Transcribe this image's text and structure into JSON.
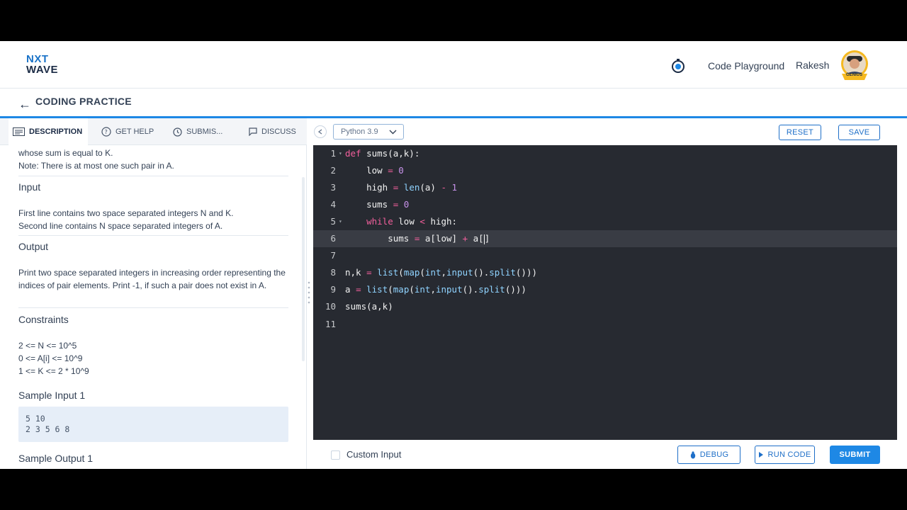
{
  "header": {
    "logo_line1": "NXT",
    "logo_line2": "WAVE",
    "nav_link": "Code Playground",
    "user_name": "Rakesh",
    "avatar_badge": "GENIUS"
  },
  "subheader": {
    "title": "CODING PRACTICE"
  },
  "tabs": [
    {
      "label": "DESCRIPTION",
      "icon": "description-icon",
      "active": true
    },
    {
      "label": "GET HELP",
      "icon": "help-icon",
      "active": false
    },
    {
      "label": "SUBMIS...",
      "icon": "clock-icon",
      "active": false
    },
    {
      "label": "DISCUSS",
      "icon": "chat-icon",
      "active": false
    }
  ],
  "description": {
    "intro_line1": "whose sum is equal to K.",
    "intro_line2": "Note: There is at most one such pair in A.",
    "input_head": "Input",
    "input_line1": "First line contains two space separated integers N and K.",
    "input_line2": "Second line contains N space separated integers of A.",
    "output_head": "Output",
    "output_text": "Print two space separated integers in increasing order representing the indices of pair elements. Print -1, if such a pair does not exist in A.",
    "constraints_head": "Constraints",
    "constraint1": "2 <= N <= 10^5",
    "constraint2": "0 <= A[i] <= 10^9",
    "constraint3": "1 <= K <= 2 * 10^9",
    "sample_input_head": "Sample Input 1",
    "sample_input_line1": "5 10",
    "sample_input_line2": "2 3 5 6 8",
    "sample_output_head": "Sample Output 1"
  },
  "toolbar": {
    "language": "Python 3.9",
    "reset_label": "RESET",
    "save_label": "SAVE"
  },
  "editor": {
    "line_numbers": [
      "1",
      "2",
      "3",
      "4",
      "5",
      "6",
      "7",
      "8",
      "9",
      "10",
      "11"
    ],
    "active_line": 6
  },
  "bottom": {
    "custom_input_label": "Custom Input",
    "debug_label": "DEBUG",
    "run_label": "RUN CODE",
    "submit_label": "SUBMIT"
  },
  "colors": {
    "accent": "#1e88e5",
    "editor_bg": "#272a31",
    "keyword": "#f25f9c",
    "number": "#c792ea"
  }
}
